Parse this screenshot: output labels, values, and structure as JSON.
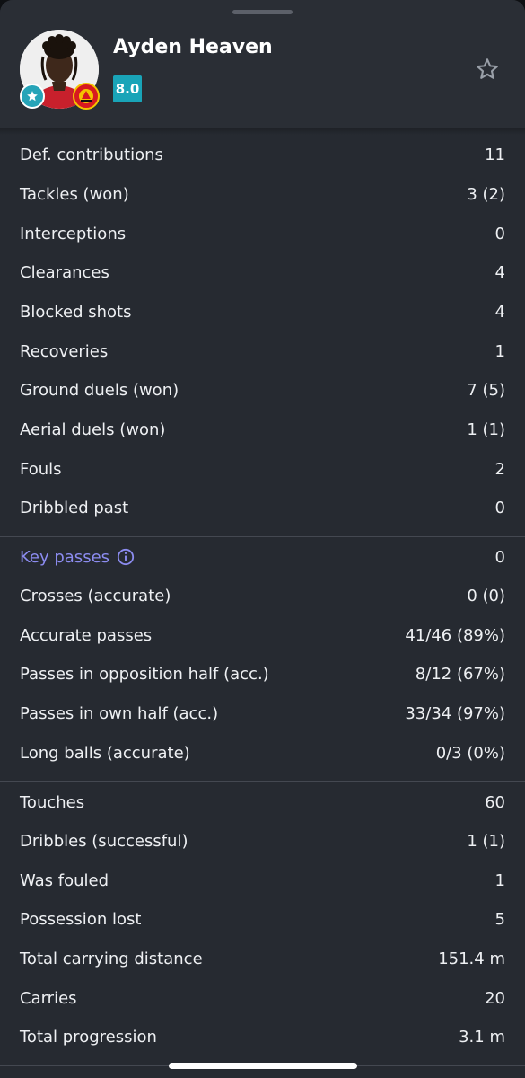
{
  "player": {
    "name": "Ayden Heaven",
    "rating": "8.0"
  },
  "colors": {
    "rating_badge": "#19a4b8",
    "link": "#8c8cf0",
    "background": "#262a31"
  },
  "icons": {
    "favorite": "star-outline-icon",
    "info": "info-circle-icon",
    "badge": "star-badge-icon",
    "club": "club-crest-icon"
  },
  "sections": [
    {
      "rows": [
        {
          "label": "Def. contributions",
          "value": "11"
        },
        {
          "label": "Tackles (won)",
          "value": "3 (2)"
        },
        {
          "label": "Interceptions",
          "value": "0"
        },
        {
          "label": "Clearances",
          "value": "4"
        },
        {
          "label": "Blocked shots",
          "value": "4"
        },
        {
          "label": "Recoveries",
          "value": "1"
        },
        {
          "label": "Ground duels (won)",
          "value": "7 (5)"
        },
        {
          "label": "Aerial duels (won)",
          "value": "1 (1)"
        },
        {
          "label": "Fouls",
          "value": "2"
        },
        {
          "label": "Dribbled past",
          "value": "0"
        }
      ]
    },
    {
      "rows": [
        {
          "label": "Key passes",
          "value": "0"
        },
        {
          "label": "Crosses (accurate)",
          "value": "0 (0)"
        },
        {
          "label": "Accurate passes",
          "value": "41/46 (89%)"
        },
        {
          "label": "Passes in opposition half (acc.)",
          "value": "8/12 (67%)"
        },
        {
          "label": "Passes in own half (acc.)",
          "value": "33/34 (97%)"
        },
        {
          "label": "Long balls (accurate)",
          "value": "0/3 (0%)"
        }
      ]
    },
    {
      "rows": [
        {
          "label": "Touches",
          "value": "60"
        },
        {
          "label": "Dribbles (successful)",
          "value": "1 (1)"
        },
        {
          "label": "Was fouled",
          "value": "1"
        },
        {
          "label": "Possession lost",
          "value": "5"
        },
        {
          "label": "Total carrying distance",
          "value": "151.4 m"
        },
        {
          "label": "Carries",
          "value": "20"
        },
        {
          "label": "Total progression",
          "value": "3.1 m"
        }
      ]
    }
  ]
}
